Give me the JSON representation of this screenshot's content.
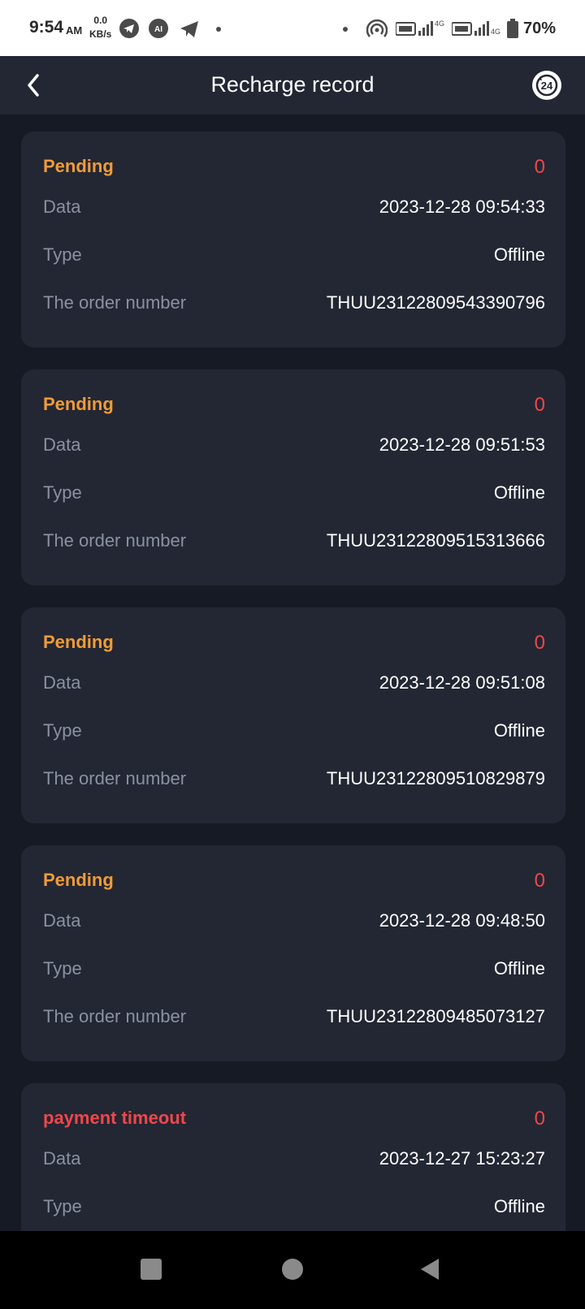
{
  "status_bar": {
    "time": "9:54",
    "ampm": "AM",
    "net_speed_value": "0.0",
    "net_speed_unit": "KB/s",
    "battery": "70%",
    "icons": [
      "telegram-icon",
      "ai-app-icon",
      "telegram-plane-icon",
      "notification-dot-icon",
      "hotspot-icon",
      "volte-signal-icon",
      "volte-signal-icon",
      "battery-icon"
    ]
  },
  "header": {
    "title": "Recharge record",
    "back_icon": "chevron-left-icon",
    "service_icon": "support-24h-icon"
  },
  "labels": {
    "date": "Data",
    "type": "Type",
    "order": "The order number"
  },
  "colors": {
    "pending": "#f29b38",
    "timeout": "#f0474c",
    "amount": "#f0474c",
    "card_bg": "#222733",
    "page_bg": "#161a24"
  },
  "records": [
    {
      "status": "Pending",
      "status_kind": "pending",
      "amount": "0",
      "date": "2023-12-28 09:54:33",
      "type": "Offline",
      "order_number": "THUU23122809543390796"
    },
    {
      "status": "Pending",
      "status_kind": "pending",
      "amount": "0",
      "date": "2023-12-28 09:51:53",
      "type": "Offline",
      "order_number": "THUU23122809515313666"
    },
    {
      "status": "Pending",
      "status_kind": "pending",
      "amount": "0",
      "date": "2023-12-28 09:51:08",
      "type": "Offline",
      "order_number": "THUU23122809510829879"
    },
    {
      "status": "Pending",
      "status_kind": "pending",
      "amount": "0",
      "date": "2023-12-28 09:48:50",
      "type": "Offline",
      "order_number": "THUU23122809485073127"
    },
    {
      "status": "payment timeout",
      "status_kind": "timeout",
      "amount": "0",
      "date": "2023-12-27 15:23:27",
      "type": "Offline",
      "order_number": ""
    }
  ],
  "nav": {
    "recents": "square-icon",
    "home": "circle-icon",
    "back": "triangle-back-icon"
  }
}
